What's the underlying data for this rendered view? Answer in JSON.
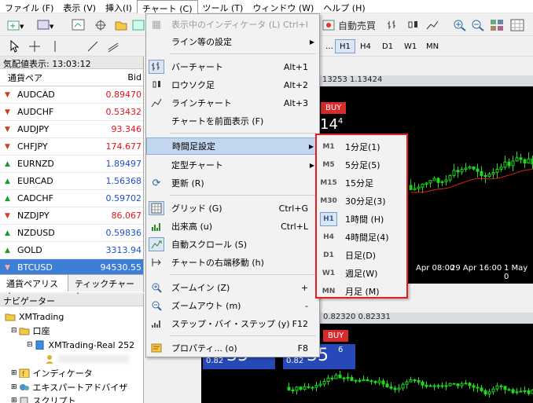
{
  "menubar": [
    "ファイル (F)",
    "表示 (V)",
    "挿入(I)",
    "チャート (C)",
    "ツール (T)",
    "ウィンドウ (W)",
    "ヘルプ (H)"
  ],
  "toolbar": {
    "auto_trade": "自動売買",
    "timeframes": [
      "H1",
      "H4",
      "D1",
      "W1",
      "MN"
    ]
  },
  "market_watch": {
    "title": "気配値表示: 13:03:12",
    "col_symbol": "通貨ペア",
    "col_bid": "Bid",
    "rows": [
      {
        "sym": "AUDCAD",
        "bid": "0.89470",
        "dir": "down",
        "color": "red"
      },
      {
        "sym": "AUDCHF",
        "bid": "0.53432",
        "dir": "down",
        "color": "red"
      },
      {
        "sym": "AUDJPY",
        "bid": "93.346",
        "dir": "down",
        "color": "red"
      },
      {
        "sym": "CHFJPY",
        "bid": "174.677",
        "dir": "down",
        "color": "red"
      },
      {
        "sym": "EURNZD",
        "bid": "1.89497",
        "dir": "up",
        "color": "blue"
      },
      {
        "sym": "EURCAD",
        "bid": "1.56368",
        "dir": "up",
        "color": "blue"
      },
      {
        "sym": "CADCHF",
        "bid": "0.59702",
        "dir": "up",
        "color": "blue"
      },
      {
        "sym": "NZDJPY",
        "bid": "86.067",
        "dir": "down",
        "color": "red"
      },
      {
        "sym": "NZDUSD",
        "bid": "0.59836",
        "dir": "up",
        "color": "blue"
      },
      {
        "sym": "GOLD",
        "bid": "3313.94",
        "dir": "up",
        "color": "blue"
      },
      {
        "sym": "BTCUSD",
        "bid": "94530.55",
        "dir": "down",
        "color": "white"
      }
    ],
    "tabs": [
      "通貨ペアリスト",
      "ティックチャート"
    ]
  },
  "navigator": {
    "title": "ナビゲーター",
    "items": [
      "XMTrading",
      "口座",
      "XMTrading-Real 252",
      "インディケータ",
      "エキスパートアドバイザ",
      "スクリプト"
    ]
  },
  "chart_top": {
    "header": "13253 1.13424",
    "buy": "BUY",
    "price": "14",
    "price_sup": "4",
    "dates": [
      "Apr 08:00",
      "29 Apr 16:00",
      "1 May 0"
    ]
  },
  "chart_bottom": {
    "header": "0.82320 0.82331",
    "buy": "BUY",
    "sell_price_small": "0.82",
    "sell_price_big": "35",
    "buy_price_small": "0.82",
    "buy_price_big": "35",
    "buy_price_sup": "6"
  },
  "chart_menu": {
    "items": [
      {
        "label": "表示中のインディケータ (L)",
        "shortcut": "Ctrl+I",
        "disabled": true
      },
      {
        "label": "ライン等の設定",
        "submenu": true
      },
      {
        "label": "バーチャート",
        "shortcut": "Alt+1"
      },
      {
        "label": "ロウソク足",
        "shortcut": "Alt+2"
      },
      {
        "label": "ラインチャート",
        "shortcut": "Alt+3"
      },
      {
        "label": "チャートを前面表示 (F)"
      },
      {
        "label": "時間足設定",
        "submenu": true
      },
      {
        "label": "定型チャート",
        "submenu": true
      },
      {
        "label": "更新 (R)"
      },
      {
        "label": "グリッド (G)",
        "shortcut": "Ctrl+G"
      },
      {
        "label": "出来高 (u)",
        "shortcut": "Ctrl+L"
      },
      {
        "label": "自動スクロール (S)"
      },
      {
        "label": "チャートの右端移動 (h)"
      },
      {
        "label": "ズームイン (Z)",
        "shortcut": "+"
      },
      {
        "label": "ズームアウト (m)",
        "shortcut": "-"
      },
      {
        "label": "ステップ・バイ・ステップ (y)",
        "shortcut": "F12"
      },
      {
        "label": "プロパティ... (o)",
        "shortcut": "F8"
      }
    ]
  },
  "timeframe_menu": {
    "items": [
      {
        "code": "M1",
        "label": "1分足(1)"
      },
      {
        "code": "M5",
        "label": "5分足(5)"
      },
      {
        "code": "M15",
        "label": "15分足"
      },
      {
        "code": "M30",
        "label": "30分足(3)"
      },
      {
        "code": "H1",
        "label": "1時間 (H)"
      },
      {
        "code": "H4",
        "label": "4時間足(4)"
      },
      {
        "code": "D1",
        "label": "日足(D)"
      },
      {
        "code": "W1",
        "label": "週足(W)"
      },
      {
        "code": "MN",
        "label": "月足 (M)"
      }
    ]
  }
}
